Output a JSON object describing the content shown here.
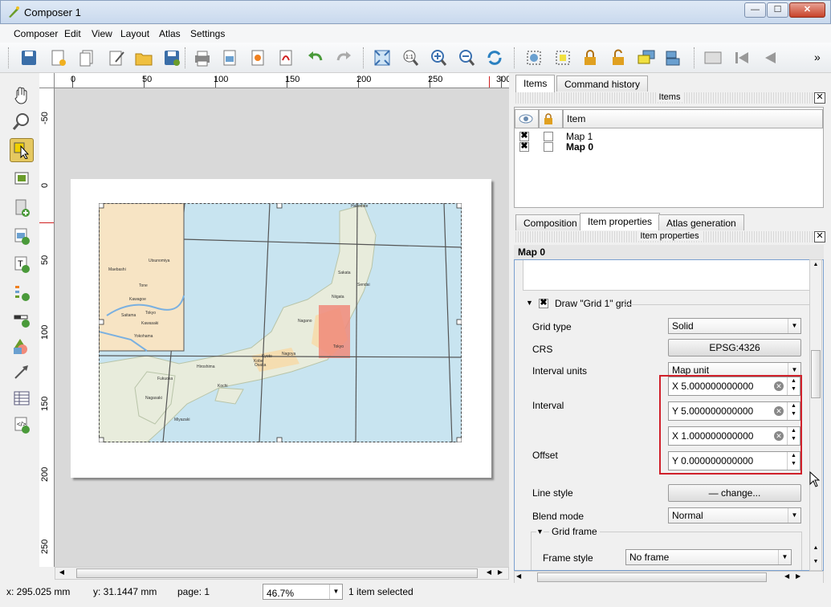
{
  "window": {
    "title": "Composer 1",
    "min": "—",
    "max": "☐",
    "close": "✕"
  },
  "menu": [
    "Composer",
    "Edit",
    "View",
    "Layout",
    "Atlas",
    "Settings"
  ],
  "toolbar": {
    "more": "»"
  },
  "ruler": {
    "h": [
      "0",
      "50",
      "100",
      "150",
      "200",
      "250",
      "300"
    ],
    "v": [
      "-50",
      "0",
      "50",
      "100",
      "150",
      "200",
      "250"
    ]
  },
  "map": {
    "labels": [
      "Hakodate",
      "Sakata",
      "Sendai",
      "Niigata",
      "Nagano",
      "Tokyo",
      "Kyoto",
      "Nagoya",
      "Osaka",
      "Kobe",
      "Hiroshima",
      "Kochi",
      "Fukuoka",
      "Nagasaki",
      "Miyazaki"
    ],
    "inset_labels": [
      "Utsunomiya",
      "Maebashi",
      "Kawagoe",
      "Tokyo",
      "Saitama",
      "Kawasaki",
      "Yokohama",
      "Tone"
    ],
    "colors": {
      "sea": "#c8e4f0",
      "land": "#e8ecdc",
      "inset": "#f7e4c4",
      "highlight": "#f08a7a"
    }
  },
  "status": {
    "x": "x: 295.025 mm",
    "y": "y: 31.1447 mm",
    "page": "page: 1",
    "zoom": "46.7%",
    "selected": "1 item selected"
  },
  "panel": {
    "tabs_top": [
      "Items",
      "Command history"
    ],
    "items_title": "Items",
    "items_header": {
      "item": "Item"
    },
    "items": [
      {
        "name": "Map 1",
        "visible": "✖"
      },
      {
        "name": "Map 0",
        "visible": "✖"
      }
    ],
    "tabs_bottom": [
      "Composition",
      "Item properties",
      "Atlas generation"
    ],
    "props_title": "Item properties",
    "object": "Map 0",
    "grid_section": "Draw \"Grid 1\" grid",
    "grid_type_label": "Grid type",
    "grid_type": "Solid",
    "crs_label": "CRS",
    "crs": "EPSG:4326",
    "interval_units_label": "Interval units",
    "interval_units": "Map unit",
    "interval_label": "Interval",
    "interval_x": "X 5.000000000000",
    "interval_y": "Y 5.000000000000",
    "offset_label": "Offset",
    "offset_x": "X 1.000000000000",
    "offset_y": "Y 0.000000000000",
    "line_style_label": "Line style",
    "line_style": "— change...",
    "blend_mode_label": "Blend mode",
    "blend_mode": "Normal",
    "grid_frame": "Grid frame",
    "frame_style_label": "Frame style",
    "frame_style": "No frame",
    "highlight_color": "#d0202a"
  }
}
